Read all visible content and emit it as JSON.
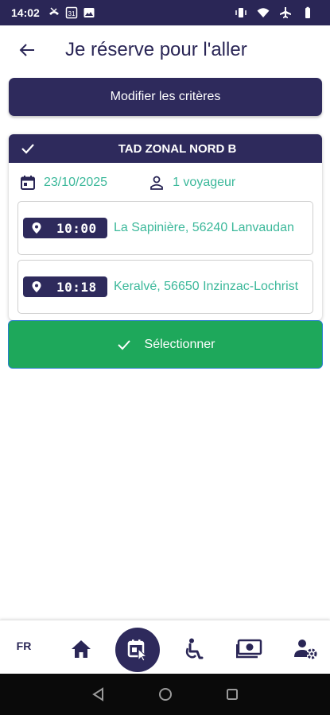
{
  "status_bar": {
    "time": "14:02",
    "left_icons": [
      "missed-call-icon",
      "calendar-31-icon",
      "image-icon"
    ],
    "calendar_day": "31",
    "right_icons": [
      "vibrate-icon",
      "wifi-icon",
      "airplane-icon",
      "battery-icon"
    ]
  },
  "header": {
    "title": "Je réserve pour l'aller"
  },
  "modify_button": {
    "label": "Modifier les critères"
  },
  "trip": {
    "line_name": "TAD ZONAL NORD B",
    "date": "23/10/2025",
    "passengers": "1 voyageur",
    "stops": [
      {
        "time": "10:00",
        "address": "La Sapinière, 56240 Lanvaudan"
      },
      {
        "time": "10:18",
        "address": "Keralvé, 56650 Inzinzac-Lochrist"
      }
    ]
  },
  "select_button": {
    "label": "Sélectionner"
  },
  "bottom_nav": {
    "language": "FR",
    "items": [
      "home-icon",
      "reservation-icon",
      "wheelchair-icon",
      "money-icon",
      "account-settings-icon"
    ],
    "active": "reservation-icon"
  },
  "colors": {
    "primary": "#2e2a5c",
    "accent_green": "#3bb89a",
    "button_green": "#1ea85b"
  }
}
